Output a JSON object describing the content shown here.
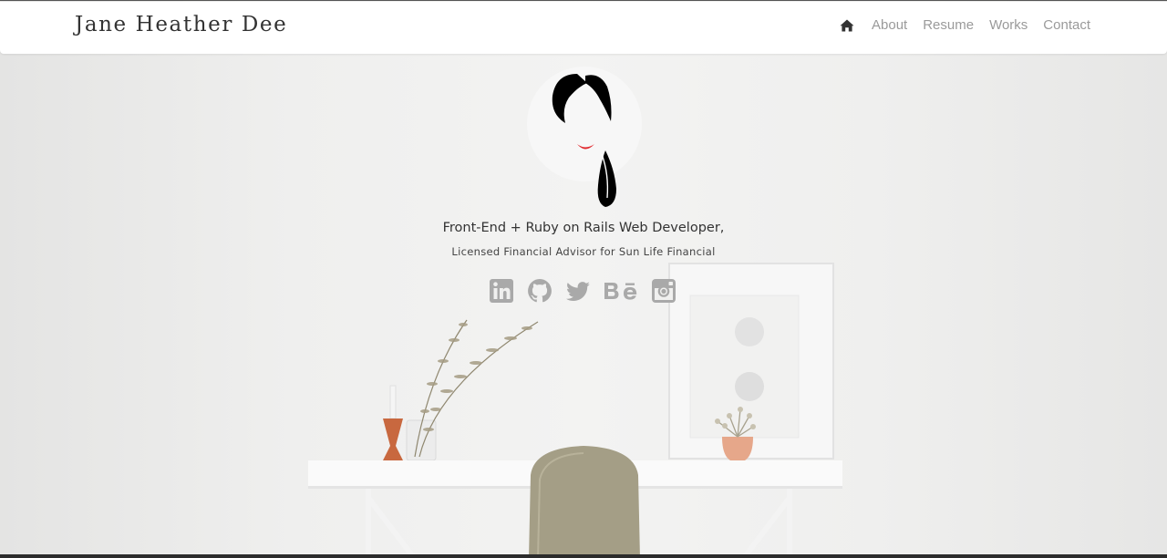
{
  "header": {
    "brand": "Jane Heather Dee",
    "nav": {
      "home_icon": "home-icon",
      "items": [
        {
          "label": "About"
        },
        {
          "label": "Resume"
        },
        {
          "label": "Works"
        },
        {
          "label": "Contact"
        }
      ]
    }
  },
  "hero": {
    "avatar_icon": "woman-portrait-illustration",
    "headline": "Front-End + Ruby on Rails Web Developer,",
    "subheadline": "Licensed Financial Advisor for Sun Life Financial",
    "socials": [
      {
        "icon": "linkedin-icon"
      },
      {
        "icon": "github-icon"
      },
      {
        "icon": "twitter-icon"
      },
      {
        "icon": "behance-icon"
      },
      {
        "icon": "instagram-icon"
      }
    ],
    "social_color": "#a9a9a9"
  },
  "colors": {
    "background": "#efefee",
    "navbar": "#ffffff",
    "nav_link": "#9a9a9a",
    "brand": "#333333",
    "lips": "#e0262b"
  }
}
